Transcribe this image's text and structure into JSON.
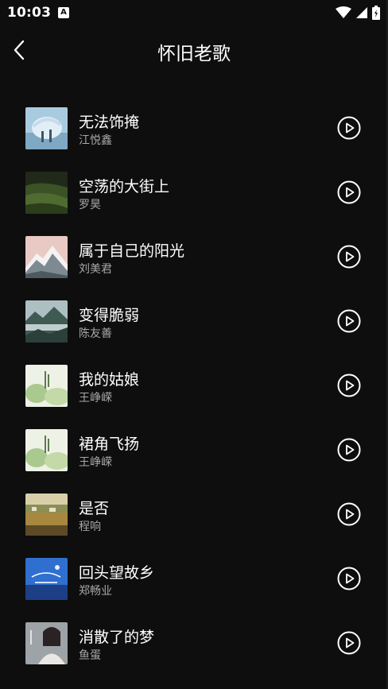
{
  "status_bar": {
    "time": "10:03",
    "notification_icon": "a-box-icon",
    "icons": [
      "wifi-icon",
      "cell-signal-icon",
      "battery-icon"
    ]
  },
  "header": {
    "title": "怀旧老歌",
    "back_icon": "chevron-left-icon"
  },
  "songs": [
    {
      "title": "无法饰掩",
      "artist": "江悦鑫",
      "cover": "frosty-tree-cover"
    },
    {
      "title": "空荡的大街上",
      "artist": "罗昊",
      "cover": "green-hills-cover"
    },
    {
      "title": "属于自己的阳光",
      "artist": "刘美君",
      "cover": "pink-mountain-cover"
    },
    {
      "title": "变得脆弱",
      "artist": "陈友善",
      "cover": "misty-mountain-cover"
    },
    {
      "title": "我的姑娘",
      "artist": "王峥嵘",
      "cover": "watercolor-cover"
    },
    {
      "title": "裙角飞扬",
      "artist": "王峥嵘",
      "cover": "watercolor-cover"
    },
    {
      "title": "是否",
      "artist": "程响",
      "cover": "field-village-cover"
    },
    {
      "title": "回头望故乡",
      "artist": "郑畅业",
      "cover": "blue-night-cover"
    },
    {
      "title": "消散了的梦",
      "artist": "鱼蛋",
      "cover": "portrait-cover"
    }
  ],
  "colors": {
    "background": "#0e0e0e",
    "title_text": "#ffffff",
    "artist_text": "#a8a8a8"
  }
}
